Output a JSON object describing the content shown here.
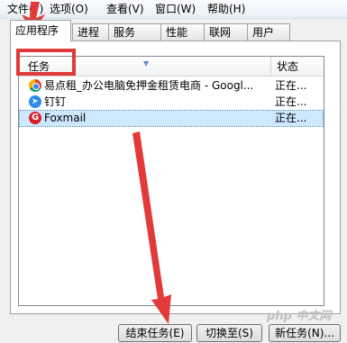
{
  "menu": [
    "文件(F)",
    "选项(O)",
    "查看(V)",
    "窗口(W)",
    "帮助(H)"
  ],
  "tabs": [
    "应用程序",
    "进程",
    "服务",
    "性能",
    "联网",
    "用户"
  ],
  "list": {
    "columns": [
      "任务",
      "状态"
    ],
    "rows": [
      {
        "name": "易点租_办公电脑免押金租赁电商 - Googl...",
        "status": "正在...",
        "icon": "chrome-icon",
        "color": "#dd4b39"
      },
      {
        "name": "钉钉",
        "status": "正在...",
        "icon": "dingtalk-icon",
        "color": "#2d8cf0"
      },
      {
        "name": "Foxmail",
        "status": "正在...",
        "icon": "foxmail-icon",
        "color": "#d6202b"
      }
    ]
  },
  "buttons": [
    "结束任务(E)",
    "切换至(S)",
    "新任务(N)..."
  ],
  "watermark": "php 中文网",
  "colors": {
    "annotation": "#e23a3a",
    "selection": "#cde8ff"
  }
}
